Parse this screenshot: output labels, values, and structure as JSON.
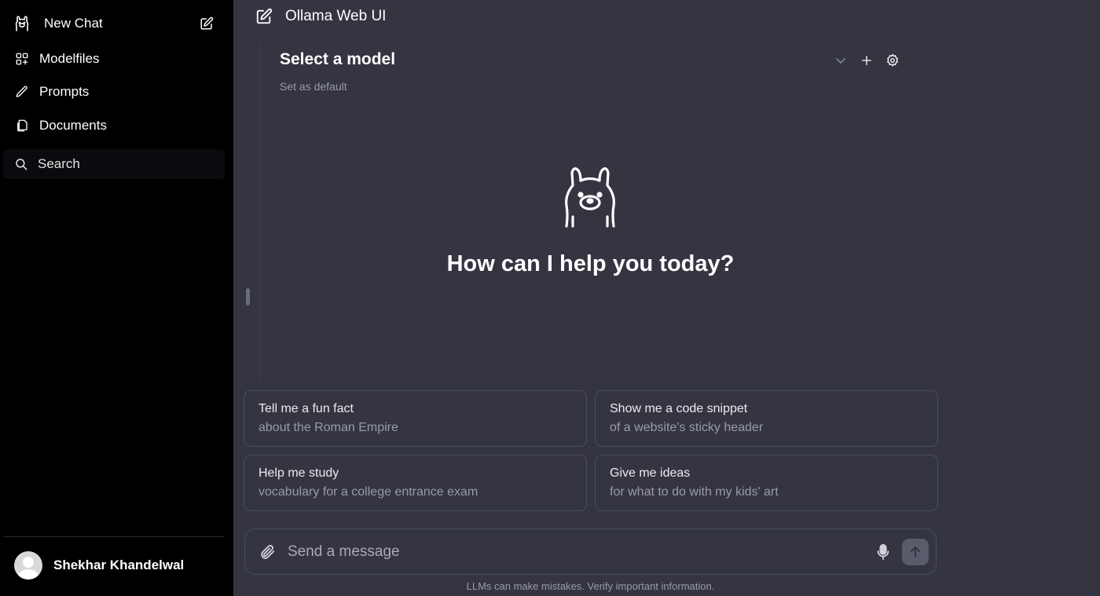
{
  "sidebar": {
    "new_chat_label": "New Chat",
    "items": [
      {
        "label": "Modelfiles",
        "icon": "modelfiles-icon"
      },
      {
        "label": "Prompts",
        "icon": "pencil-icon"
      },
      {
        "label": "Documents",
        "icon": "documents-icon"
      }
    ],
    "search_label": "Search",
    "user_name": "Shekhar Khandelwal"
  },
  "header": {
    "title": "Ollama Web UI"
  },
  "model_selector": {
    "title": "Select a model",
    "set_default": "Set as default"
  },
  "hero": {
    "greeting": "How can I help you today?"
  },
  "suggestions": [
    {
      "title": "Tell me a fun fact",
      "subtitle": "about the Roman Empire"
    },
    {
      "title": "Show me a code snippet",
      "subtitle": "of a website's sticky header"
    },
    {
      "title": "Help me study",
      "subtitle": "vocabulary for a college entrance exam"
    },
    {
      "title": "Give me ideas",
      "subtitle": "for what to do with my kids' art"
    }
  ],
  "composer": {
    "placeholder": "Send a message"
  },
  "footer": {
    "disclaimer": "LLMs can make mistakes. Verify important information."
  },
  "colors": {
    "sidebar_bg": "#000000",
    "main_bg": "#343541",
    "border": "#4d4e5d",
    "muted_text": "#9a9aa8"
  }
}
